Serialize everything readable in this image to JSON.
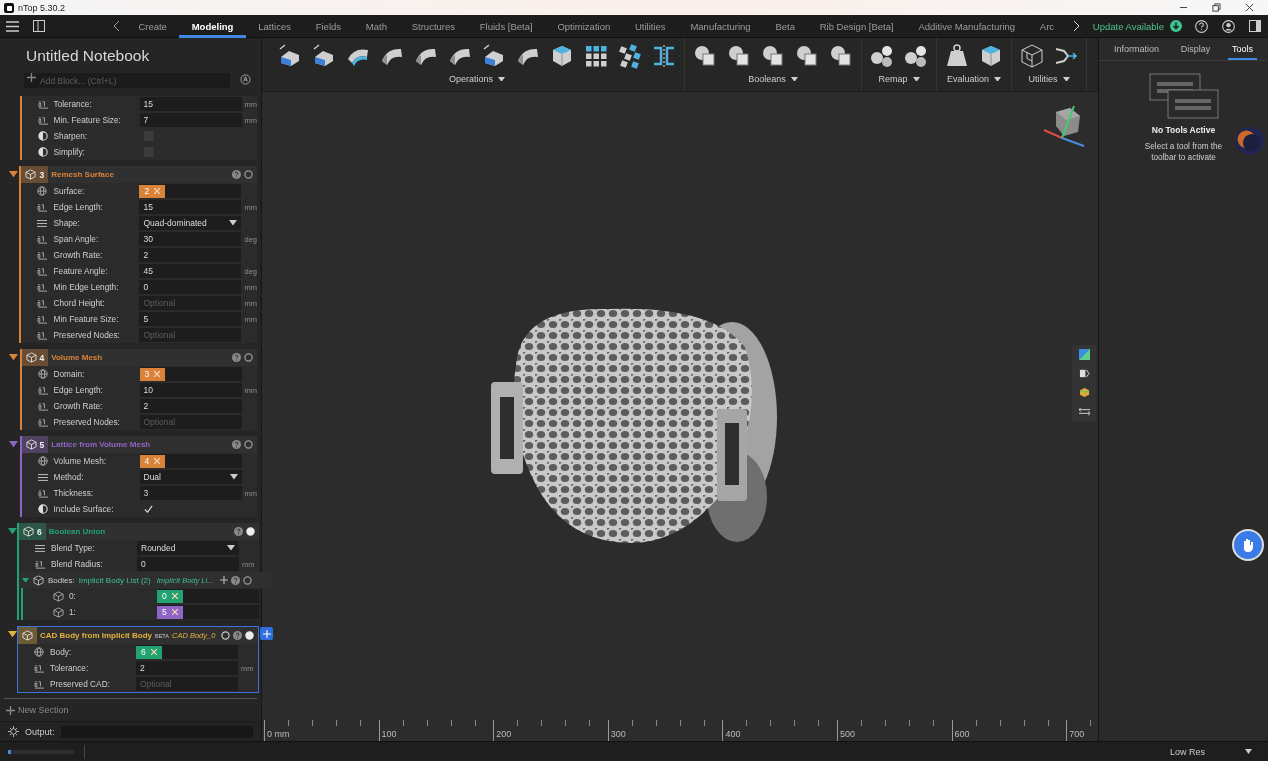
{
  "window": {
    "title": "nTop 5.30.2"
  },
  "menu": {
    "tabs": [
      {
        "label": "Create",
        "selected": false
      },
      {
        "label": "Modeling",
        "selected": true
      },
      {
        "label": "Lattices",
        "selected": false
      },
      {
        "label": "Fields",
        "selected": false
      },
      {
        "label": "Math",
        "selected": false
      },
      {
        "label": "Structures",
        "selected": false
      },
      {
        "label": "Fluids [Beta]",
        "selected": false
      },
      {
        "label": "Optimization",
        "selected": false
      },
      {
        "label": "Utilities",
        "selected": false
      },
      {
        "label": "Manufacturing",
        "selected": false
      },
      {
        "label": "Beta",
        "selected": false
      },
      {
        "label": "Rib Design [Beta]",
        "selected": false
      },
      {
        "label": "Additive Manufacturing",
        "selected": false
      },
      {
        "label": "Arc",
        "selected": false
      }
    ],
    "update": "Update Available"
  },
  "notebook": {
    "title": "Untitled Notebook",
    "add_placeholder": "Add Block... (Ctrl+L)",
    "blocks": [
      {
        "color": "#d9833a",
        "selected": false,
        "rows": [
          {
            "kind": "number",
            "label": "Tolerance:",
            "value": "15",
            "unit": "mm"
          },
          {
            "kind": "number",
            "label": "Min. Feature Size:",
            "value": "7",
            "unit": "mm"
          },
          {
            "kind": "checkbox",
            "label": "Sharpen:",
            "checked": false
          },
          {
            "kind": "checkbox",
            "label": "Simplify:",
            "checked": false
          }
        ]
      },
      {
        "number": "3",
        "title": "Remesh Surface",
        "color": "#d9833a",
        "selected": false,
        "visible": false,
        "rows": [
          {
            "kind": "reference",
            "label": "Surface:",
            "ref": "2",
            "color": "#d9833a"
          },
          {
            "kind": "number",
            "label": "Edge Length:",
            "value": "15",
            "unit": "mm"
          },
          {
            "kind": "dropdown",
            "label": "Shape:",
            "value": "Quad-dominated"
          },
          {
            "kind": "number",
            "label": "Span Angle:",
            "value": "30",
            "unit": "deg"
          },
          {
            "kind": "number",
            "label": "Growth Rate:",
            "value": "2"
          },
          {
            "kind": "number",
            "label": "Feature Angle:",
            "value": "45",
            "unit": "deg"
          },
          {
            "kind": "number",
            "label": "Min Edge Length:",
            "value": "0",
            "unit": "mm"
          },
          {
            "kind": "number",
            "label": "Chord Height:",
            "placeholder": "Optional",
            "unit": "mm"
          },
          {
            "kind": "number",
            "label": "Min Feature Size:",
            "value": "5",
            "unit": "mm"
          },
          {
            "kind": "number",
            "label": "Preserved Nodes:",
            "placeholder": "Optional"
          }
        ]
      },
      {
        "number": "4",
        "title": "Volume Mesh",
        "color": "#d9833a",
        "selected": false,
        "visible": false,
        "rows": [
          {
            "kind": "reference",
            "label": "Domain:",
            "ref": "3",
            "color": "#d9833a"
          },
          {
            "kind": "number",
            "label": "Edge Length:",
            "value": "10",
            "unit": "mm"
          },
          {
            "kind": "number",
            "label": "Growth Rate:",
            "value": "2"
          },
          {
            "kind": "number",
            "label": "Preserved Nodes:",
            "placeholder": "Optional"
          }
        ]
      },
      {
        "number": "5",
        "title": "Lattice from Volume Mesh",
        "color": "#8f66c6",
        "selected": false,
        "visible": false,
        "rows": [
          {
            "kind": "reference",
            "label": "Volume Mesh:",
            "ref": "4",
            "color": "#d9833a"
          },
          {
            "kind": "dropdown",
            "label": "Method:",
            "value": "Dual"
          },
          {
            "kind": "number",
            "label": "Thickness:",
            "value": "3",
            "unit": "mm"
          },
          {
            "kind": "checkbox",
            "label": "Include Surface:",
            "checked": true
          }
        ]
      },
      {
        "number": "6",
        "title": "Boolean Union",
        "color": "#23a271",
        "selected": false,
        "visible": true,
        "rows": [
          {
            "kind": "dropdown",
            "label": "Blend Type:",
            "value": "Rounded"
          },
          {
            "kind": "number",
            "label": "Blend Radius:",
            "value": "0",
            "unit": "mm"
          },
          {
            "kind": "list",
            "label": "Bodies:",
            "value": "Implicit Body List (2)",
            "alias": "Implicit Body Li...",
            "items": [
              {
                "label": "0:",
                "ref": "0",
                "color": "#23a271"
              },
              {
                "label": "1:",
                "ref": "5",
                "color": "#8f66c6"
              }
            ]
          }
        ]
      },
      {
        "title": "CAD Body from Implicit Body",
        "badge": "BETA",
        "alias": "CAD Body_0",
        "color": "#e3b23c",
        "selected": true,
        "visible": true,
        "rows": [
          {
            "kind": "reference",
            "label": "Body:",
            "ref": "6",
            "color": "#23a271"
          },
          {
            "kind": "number",
            "label": "Tolerance:",
            "value": "2",
            "unit": "mm"
          },
          {
            "kind": "number",
            "label": "Preserved CAD:",
            "placeholder": "Optional"
          }
        ]
      }
    ],
    "new_section": "New Section",
    "output_label": "Output:"
  },
  "toolbar": {
    "groups": [
      {
        "label": "Operations"
      },
      {
        "label": "Booleans"
      },
      {
        "label": "Remap"
      },
      {
        "label": "Evaluation"
      },
      {
        "label": "Utilities"
      }
    ]
  },
  "viewport": {
    "ruler": [
      "0 mm",
      "100",
      "200",
      "300",
      "400",
      "500",
      "600",
      "700"
    ]
  },
  "right_panel": {
    "tabs": [
      {
        "label": "Information",
        "selected": false
      },
      {
        "label": "Display",
        "selected": false
      },
      {
        "label": "Tools",
        "selected": true
      }
    ],
    "heading": "No Tools Active",
    "message": "Select a tool from the toolbar to activate"
  },
  "status_bar": {
    "progress": {
      "level": 0.04
    },
    "resolution": "Low Res"
  }
}
